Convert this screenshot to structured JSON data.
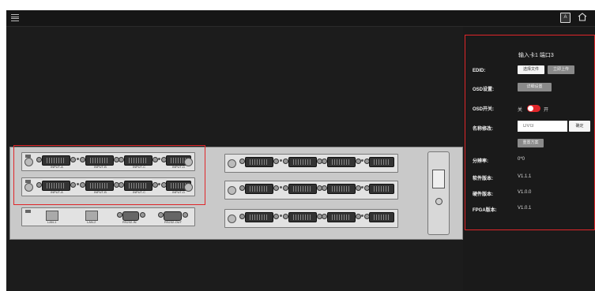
{
  "topbar": {
    "menu_icon": "menu-icon",
    "language_icon": "language-icon",
    "language_glyph": "A",
    "home_icon": "home-icon"
  },
  "ports": {
    "row1": [
      "INPUT-A",
      "INPUT-B",
      "INPUT-C",
      "INPUT-D"
    ],
    "row2": [
      "INPUT-A",
      "INPUT-B",
      "INPUT-C",
      "INPUT-D"
    ],
    "control": [
      "LAN-1",
      "LAN-2",
      "RS232-IN",
      "RS232-OUT"
    ]
  },
  "panel": {
    "title": "输入卡1 端口3",
    "edid_label": "EDID:",
    "edid_select_btn": "选择文件",
    "edid_upload_btn": "立即上传",
    "osd_settings_label": "OSD设置:",
    "osd_detail_btn": "详细设置",
    "osd_switch_label": "OSD开关:",
    "osd_off": "关",
    "osd_on": "开",
    "osd_switch_state": "on",
    "name_edit_label": "名称修改:",
    "name_input_placeholder": "DVI3",
    "name_confirm_btn": "确定",
    "reset_btn": "重置方案",
    "resolution_label": "分辨率:",
    "resolution_value": "0*0",
    "software_label": "软件版本:",
    "software_value": "V1.1.1",
    "hardware_label": "硬件版本:",
    "hardware_value": "V1.0.0",
    "fpga_label": "FPGA版本:",
    "fpga_value": "V1.0.1"
  },
  "colors": {
    "accent_red": "#e0262a",
    "app_bg": "#1a1a1a"
  }
}
